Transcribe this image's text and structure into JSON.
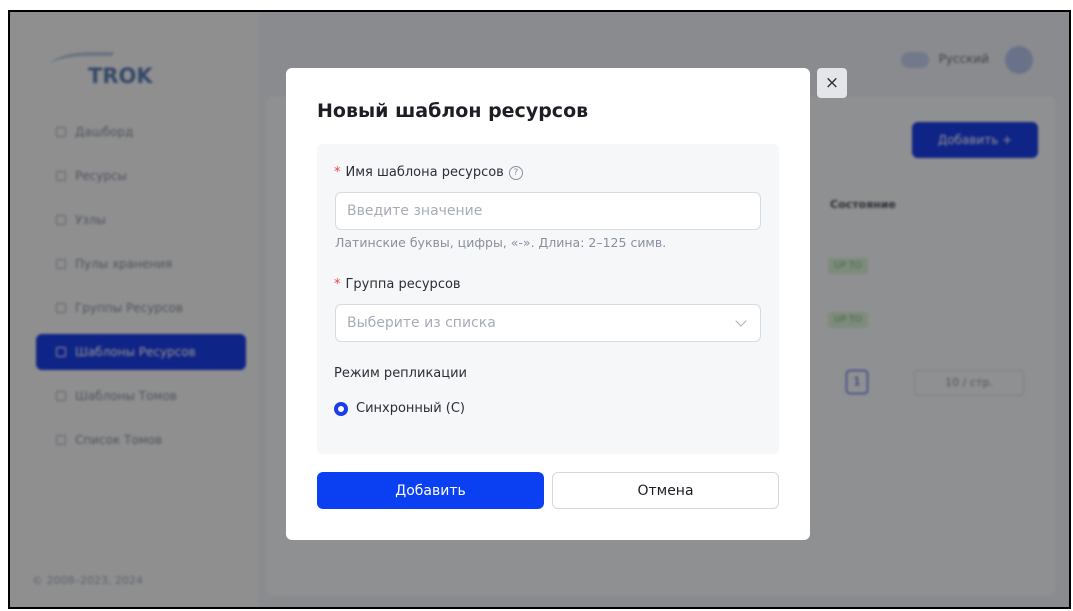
{
  "app": {
    "logo_text": "TROK",
    "language": "Русский",
    "sidebar": {
      "items": [
        {
          "label": "Дашборд",
          "active": false
        },
        {
          "label": "Ресурсы",
          "active": false
        },
        {
          "label": "Узлы",
          "active": false
        },
        {
          "label": "Пулы хранения",
          "active": false
        },
        {
          "label": "Группы Ресурсов",
          "active": false
        },
        {
          "label": "Шаблоны Ресурсов",
          "active": true
        },
        {
          "label": "Шаблоны Томов",
          "active": false
        },
        {
          "label": "Список Томов",
          "active": false
        }
      ],
      "footer": "© 2008–2023, 2024"
    },
    "content": {
      "add_button": "Добавить +",
      "column_status": "Состояние",
      "status_tags": [
        "UP TO",
        "UP TO"
      ],
      "current_page": "1",
      "page_size": "10 / стр."
    }
  },
  "modal": {
    "title": "Новый шаблон ресурсов",
    "close_label": "×",
    "fields": {
      "name": {
        "label": "Имя шаблона ресурсов",
        "required_mark": "*",
        "help_glyph": "?",
        "placeholder": "Введите значение",
        "value": "",
        "hint": "Латинские буквы, цифры, «-». Длина: 2–125 симв."
      },
      "group": {
        "label": "Группа ресурсов",
        "required_mark": "*",
        "placeholder": "Выберите из списка"
      },
      "replication": {
        "label": "Режим репликации",
        "options": [
          {
            "label": "Синхронный (C)",
            "selected": true
          }
        ]
      }
    },
    "buttons": {
      "submit": "Добавить",
      "cancel": "Отмена"
    }
  },
  "colors": {
    "primary": "#0a3ff2",
    "required": "#e5484d",
    "overlay": "rgba(0,0,0,0.42)"
  }
}
